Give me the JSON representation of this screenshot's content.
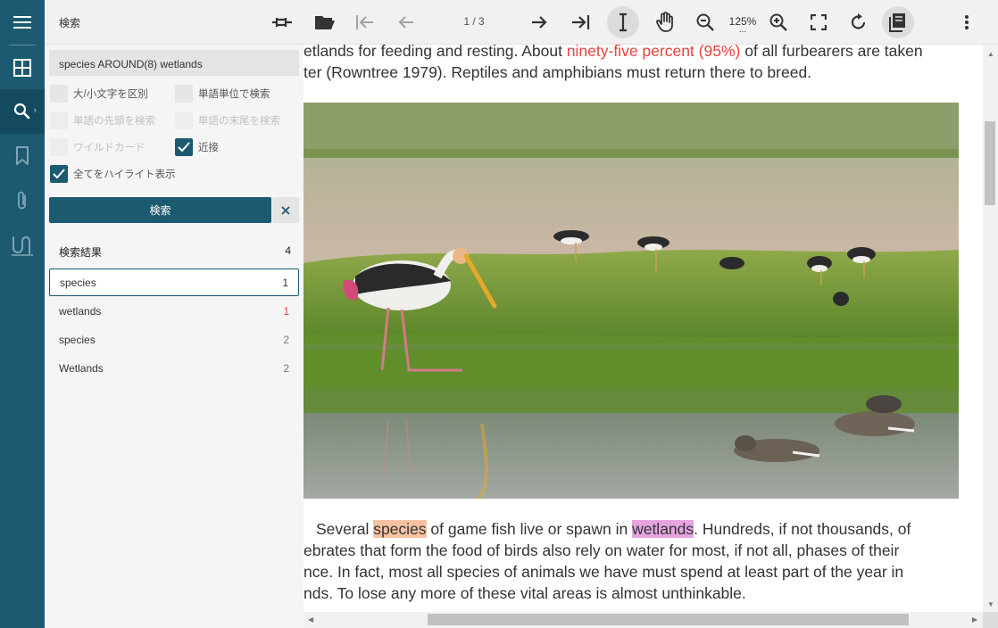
{
  "toolbar": {
    "title": "検索",
    "page_indicator": "1 / 3",
    "zoom": "125%",
    "zoom_more": "..."
  },
  "rail": {
    "items": [
      "menu-icon",
      "thumbnails-icon",
      "search-icon",
      "bookmark-icon",
      "attachment-icon",
      "signature-icon"
    ],
    "active": "search-icon"
  },
  "search": {
    "query": "species AROUND(8) wetlands",
    "options": {
      "case_sensitive": {
        "label": "大/小文字を区別",
        "checked": false
      },
      "whole_word": {
        "label": "単語単位で検索",
        "checked": false
      },
      "word_start": {
        "label": "単語の先頭を検索",
        "checked": false
      },
      "word_end": {
        "label": "単語の末尾を検索",
        "checked": false
      },
      "wildcard": {
        "label": "ワイルドカード",
        "checked": false
      },
      "proximity": {
        "label": "近接",
        "checked": true
      },
      "highlight_all": {
        "label": "全てをハイライト表示",
        "checked": true
      }
    },
    "button_label": "検索"
  },
  "results": {
    "header": "検索結果",
    "count": "4",
    "items": [
      {
        "term": "species",
        "page": "1"
      },
      {
        "term": "wetlands",
        "page": "1"
      },
      {
        "term": "species",
        "page": "2"
      },
      {
        "term": "Wetlands",
        "page": "2"
      }
    ]
  },
  "document": {
    "line1_a": "etlands for feeding and resting. About ",
    "line1_red": "ninety-five percent (95%)",
    "line1_b": " of all furbearers are taken",
    "line2": "ter (Rowntree 1979). Reptiles and amphibians must return there to breed.",
    "para_indent": "Several ",
    "hl_species": "species",
    "mid": " of game fish live or spawn in ",
    "hl_wetlands": "wetlands",
    "line3_tail": ". Hundreds, if not thousands, of",
    "line4": "ebrates that form the food of birds also rely on water for most, if not all, phases of their",
    "line5": "nce. In fact, most all species of animals we have must spend at least part of the year in",
    "line6": "nds. To lose any more of these vital areas is almost unthinkable."
  },
  "colors": {
    "primary": "#1c5a72",
    "highlight_species": "#f6c2a2",
    "highlight_wetlands": "#e6a5e0",
    "red_text": "#e8403b"
  }
}
